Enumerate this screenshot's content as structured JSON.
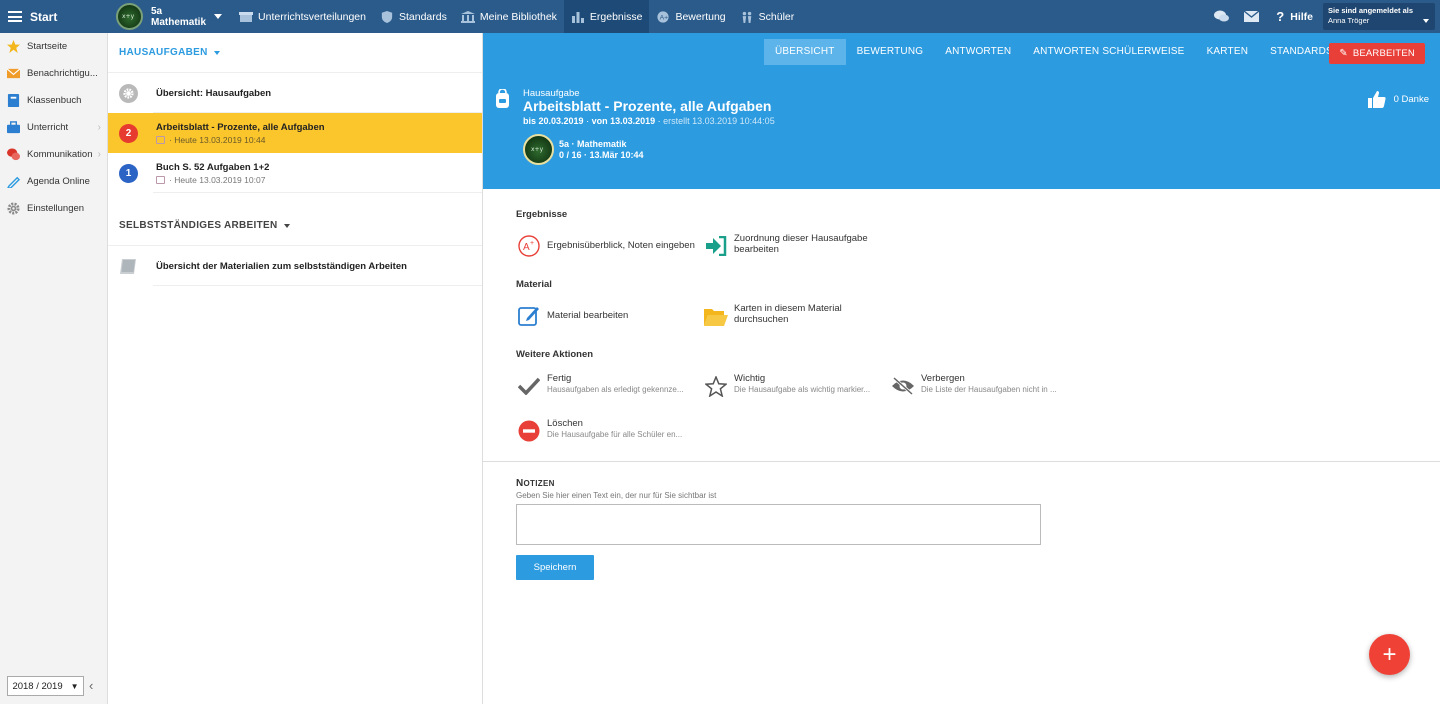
{
  "topbar": {
    "start_label": "Start",
    "course": {
      "line1": "5a",
      "line2": "Mathematik"
    },
    "nav": [
      {
        "label": "Unterrichtsverteilungen",
        "icon": "box-icon"
      },
      {
        "label": "Standards",
        "icon": "shield-icon"
      },
      {
        "label": "Meine Bibliothek",
        "icon": "library-icon"
      },
      {
        "label": "Ergebnisse",
        "icon": "bar-chart-icon",
        "active": true
      },
      {
        "label": "Bewertung",
        "icon": "rating-icon"
      },
      {
        "label": "Schüler",
        "icon": "students-icon"
      }
    ],
    "help_label": "Hilfe",
    "user": {
      "caption": "Sie sind angemeldet als",
      "name": "Anna Tröger"
    }
  },
  "sidebar": {
    "items": [
      {
        "label": "Startseite",
        "icon": "star-icon"
      },
      {
        "label": "Benachrichtigu...",
        "icon": "envelope-icon"
      },
      {
        "label": "Klassenbuch",
        "icon": "book-icon"
      },
      {
        "label": "Unterricht",
        "icon": "briefcase-icon",
        "chevron": true
      },
      {
        "label": "Kommunikation",
        "icon": "chat-icon",
        "chevron": true
      },
      {
        "label": "Agenda Online",
        "icon": "pen-icon"
      },
      {
        "label": "Einstellungen",
        "icon": "gear-icon"
      }
    ],
    "year": "2018 / 2019"
  },
  "middle": {
    "homework_header": "HAUSAUFGABEN",
    "items": [
      {
        "title": "Übersicht: Hausaufgaben",
        "sub": "",
        "badge": "",
        "badge_color": "#b9b9b9"
      },
      {
        "title": "Arbeitsblatt - Prozente, alle Aufgaben",
        "sub": "Heute 13.03.2019 10:44",
        "badge": "2",
        "badge_color": "#e63b2e",
        "active": true
      },
      {
        "title": "Buch S. 52 Aufgaben 1+2",
        "sub": "Heute 13.03.2019 10:07",
        "badge": "1",
        "badge_color": "#2b64c4"
      }
    ],
    "self_header": "SELBSTSTÄNDIGES ARBEITEN",
    "self_item": "Übersicht der Materialien zum selbstständigen Arbeiten"
  },
  "tabs": [
    "ÜBERSICHT",
    "BEWERTUNG",
    "ANTWORTEN",
    "ANTWORTEN SCHÜLERWEISE",
    "KARTEN",
    "STANDARDS"
  ],
  "edit_label": "BEARBEITEN",
  "hero": {
    "kind": "Hausaufgabe",
    "title": "Arbeitsblatt - Prozente, alle Aufgaben",
    "due": "bis 20.03.2019",
    "from": "von 13.03.2019",
    "created": "erstellt 13.03.2019 10:44:05",
    "course_name": "5a · Mathematik",
    "course_stats": "0 / 16 · 13.Mär 10:44",
    "thanks": "0 Danke"
  },
  "groups": {
    "results": {
      "title": "Ergebnisse",
      "a1": "Ergebnisüberblick, Noten eingeben",
      "a2_1": "Zuordnung dieser Hausaufgabe",
      "a2_2": "bearbeiten"
    },
    "material": {
      "title": "Material",
      "a1": "Material bearbeiten",
      "a2_1": "Karten in diesem Material",
      "a2_2": "durchsuchen"
    },
    "more": {
      "title": "Weitere Aktionen",
      "done_t": "Fertig",
      "done_d": "Hausaufgaben als erledigt gekennze...",
      "imp_t": "Wichtig",
      "imp_d": "Die Hausaufgabe als wichtig markier...",
      "hide_t": "Verbergen",
      "hide_d": "Die Liste der Hausaufgaben nicht in ...",
      "del_t": "Löschen",
      "del_d": "Die Hausaufgabe für alle Schüler en..."
    }
  },
  "notes": {
    "title_first": "N",
    "title_rest": "OTIZEN",
    "hint": "Geben Sie hier einen Text ein, der nur für Sie sichtbar ist",
    "value": "",
    "save_label": "Speichern"
  },
  "fab_label": "+",
  "colors": {
    "topbar": "#2b5b8a",
    "accent": "#2c9be0",
    "active_item": "#fbc52c",
    "danger": "#e84038"
  }
}
